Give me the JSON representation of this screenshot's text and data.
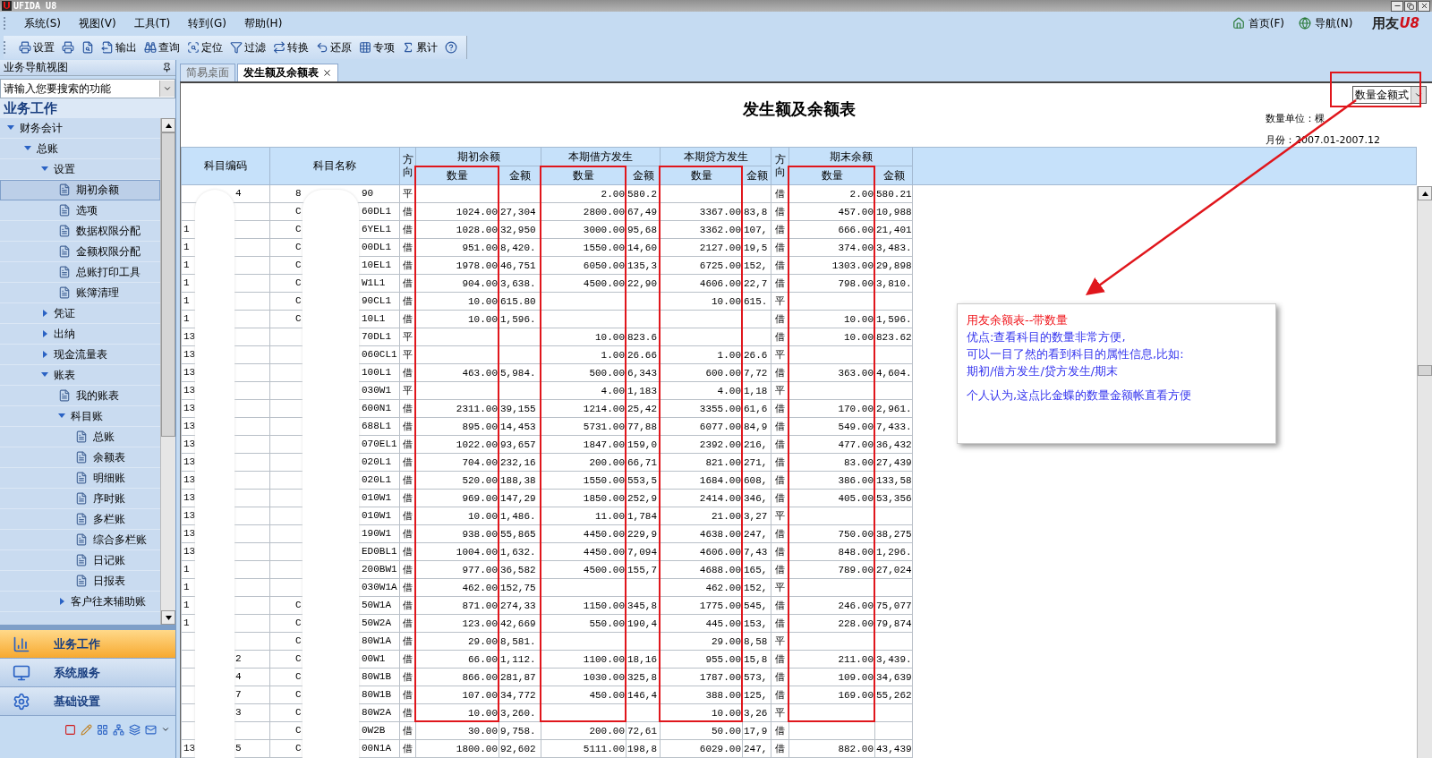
{
  "window": {
    "title": "UFIDA U8"
  },
  "menu": [
    "系统(S)",
    "视图(V)",
    "工具(T)",
    "转到(G)",
    "帮助(H)"
  ],
  "toolbar": [
    {
      "kind": "print",
      "label": "设置"
    },
    {
      "kind": "printer"
    },
    {
      "kind": "preview"
    },
    {
      "kind": "export",
      "label": "输出"
    },
    {
      "kind": "query",
      "label": "查询"
    },
    {
      "kind": "locate",
      "label": "定位"
    },
    {
      "kind": "filter",
      "label": "过滤"
    },
    {
      "kind": "convert",
      "label": "转换"
    },
    {
      "kind": "undo",
      "label": "还原"
    },
    {
      "kind": "grid",
      "label": "专项"
    },
    {
      "kind": "sum",
      "label": "累计"
    },
    {
      "kind": "help"
    }
  ],
  "top_links": [
    {
      "kind": "home",
      "label": "首页(F)"
    },
    {
      "kind": "globe",
      "label": "导航(N)"
    }
  ],
  "logo": {
    "text": "用友",
    "mark": "U8"
  },
  "sidebar": {
    "title": "业务导航视图",
    "search": "请输入您要搜索的功能",
    "section": "业务工作",
    "tree": [
      {
        "label": "财务会计",
        "expanded": true,
        "children": [
          {
            "label": "总账",
            "expanded": true,
            "children": [
              {
                "label": "设置",
                "expanded": true,
                "children": [
                  {
                    "label": "期初余额",
                    "selected": true
                  },
                  {
                    "label": "选项",
                    "selected": false
                  },
                  {
                    "label": "数据权限分配",
                    "selected": false
                  },
                  {
                    "label": "金额权限分配",
                    "selected": false
                  },
                  {
                    "label": "总账打印工具",
                    "selected": false
                  },
                  {
                    "label": "账簿清理",
                    "selected": false
                  }
                ]
              },
              {
                "label": "凭证",
                "expanded": false
              },
              {
                "label": "出纳",
                "expanded": false
              },
              {
                "label": "现金流量表",
                "expanded": false
              },
              {
                "label": "账表",
                "expanded": true,
                "children": [
                  {
                    "label": "我的账表",
                    "selected": false
                  },
                  {
                    "label": "科目账",
                    "expanded": true,
                    "children": [
                      {
                        "label": "总账",
                        "selected": false
                      },
                      {
                        "label": "余额表",
                        "selected": false
                      },
                      {
                        "label": "明细账",
                        "selected": false
                      },
                      {
                        "label": "序时账",
                        "selected": false
                      },
                      {
                        "label": "多栏账",
                        "selected": false
                      },
                      {
                        "label": "综合多栏账",
                        "selected": false
                      },
                      {
                        "label": "日记账",
                        "selected": false
                      },
                      {
                        "label": "日报表",
                        "selected": false
                      }
                    ]
                  },
                  {
                    "label": "客户往来辅助账",
                    "expanded": false
                  }
                ]
              }
            ]
          }
        ]
      }
    ],
    "nav_buttons": [
      {
        "kind": "chart",
        "label": "业务工作",
        "selected": true
      },
      {
        "kind": "monitor",
        "label": "系统服务",
        "selected": false
      },
      {
        "kind": "gear",
        "label": "基础设置",
        "selected": false
      }
    ]
  },
  "tabs": [
    {
      "label": "简易桌面",
      "selected": false,
      "closable": false
    },
    {
      "label": "发生额及余额表",
      "selected": true,
      "closable": true
    }
  ],
  "report": {
    "title": "发生额及余额表",
    "mode": "数量金额式",
    "unit": "数量单位：棵",
    "period": "月份：2007.01-2007.12",
    "header": [
      {
        "kind": "single",
        "label": "科目编码"
      },
      {
        "kind": "single",
        "label": "科目名称"
      },
      {
        "kind": "narrow",
        "label": "方向"
      },
      {
        "kind": "group",
        "title": "期初余额",
        "sub": [
          "数量",
          "金额"
        ]
      },
      {
        "kind": "group",
        "title": "本期借方发生",
        "sub": [
          "数量",
          "金额"
        ]
      },
      {
        "kind": "group",
        "title": "本期贷方发生",
        "sub": [
          "数量",
          "金额"
        ]
      },
      {
        "kind": "narrow",
        "label": "方向"
      },
      {
        "kind": "group",
        "title": "期末余额",
        "sub": [
          "数量",
          "金额"
        ]
      }
    ],
    "rows": [
      {
        "code_tail": "4",
        "name_head": "8",
        "name_tail": "90",
        "dir": "平",
        "debit_qty": "2.00",
        "debit_amt": "580.2",
        "end_dir": "借",
        "close_qty": "2.00",
        "close_amt": "580.21"
      },
      {
        "name_head": "C",
        "name_tail": "60DL1",
        "dir": "借",
        "open_qty": "1024.00",
        "open_amt": "27,304",
        "debit_qty": "2800.00",
        "debit_amt": "67,49",
        "credit_qty": "3367.00",
        "credit_amt": "83,8",
        "end_dir": "借",
        "close_qty": "457.00",
        "close_amt": "10,988"
      },
      {
        "code": "1",
        "name_head": "C",
        "name_tail": "6YEL1",
        "dir": "借",
        "open_qty": "1028.00",
        "open_amt": "32,950",
        "debit_qty": "3000.00",
        "debit_amt": "95,68",
        "credit_qty": "3362.00",
        "credit_amt": "107,",
        "end_dir": "借",
        "close_qty": "666.00",
        "close_amt": "21,401"
      },
      {
        "code": "1",
        "name_head": "C",
        "name_tail": "00DL1",
        "dir": "借",
        "open_qty": "951.00",
        "open_amt": "8,420.",
        "debit_qty": "1550.00",
        "debit_amt": "14,60",
        "credit_qty": "2127.00",
        "credit_amt": "19,5",
        "end_dir": "借",
        "close_qty": "374.00",
        "close_amt": "3,483."
      },
      {
        "code": "1",
        "name_head": "C",
        "name_tail": "10EL1",
        "dir": "借",
        "open_qty": "1978.00",
        "open_amt": "46,751",
        "debit_qty": "6050.00",
        "debit_amt": "135,3",
        "credit_qty": "6725.00",
        "credit_amt": "152,",
        "end_dir": "借",
        "close_qty": "1303.00",
        "close_amt": "29,898"
      },
      {
        "code": "1",
        "name_head": "C",
        "name_tail": "W1L1",
        "dir": "借",
        "open_qty": "904.00",
        "open_amt": "3,638.",
        "debit_qty": "4500.00",
        "debit_amt": "22,90",
        "credit_qty": "4606.00",
        "credit_amt": "22,7",
        "end_dir": "借",
        "close_qty": "798.00",
        "close_amt": "3,810."
      },
      {
        "code": "1",
        "name_head": "C",
        "name_tail": "90CL1",
        "dir": "借",
        "open_qty": "10.00",
        "open_amt": "615.80",
        "credit_qty": "10.00",
        "credit_amt": "615.",
        "end_dir": "平"
      },
      {
        "code": "1",
        "name_head": "C",
        "name_tail": "10L1",
        "dir": "借",
        "open_qty": "10.00",
        "open_amt": "1,596.",
        "end_dir": "借",
        "close_qty": "10.00",
        "close_amt": "1,596."
      },
      {
        "code": "13",
        "name_tail": "70DL1",
        "dir": "平",
        "debit_qty": "10.00",
        "debit_amt": "823.6",
        "end_dir": "借",
        "close_qty": "10.00",
        "close_amt": "823.62"
      },
      {
        "code": "13",
        "name_tail": "060CL1",
        "dir": "平",
        "debit_qty": "1.00",
        "debit_amt": "26.66",
        "credit_qty": "1.00",
        "credit_amt": "26.6",
        "end_dir": "平"
      },
      {
        "code": "13",
        "name_tail": "100L1",
        "dir": "借",
        "open_qty": "463.00",
        "open_amt": "5,984.",
        "debit_qty": "500.00",
        "debit_amt": "6,343",
        "credit_qty": "600.00",
        "credit_amt": "7,72",
        "end_dir": "借",
        "close_qty": "363.00",
        "close_amt": "4,604."
      },
      {
        "code": "13",
        "name_tail": "030W1",
        "dir": "平",
        "debit_qty": "4.00",
        "debit_amt": "1,183",
        "credit_qty": "4.00",
        "credit_amt": "1,18",
        "end_dir": "平"
      },
      {
        "code": "13",
        "name_tail": "600N1",
        "dir": "借",
        "open_qty": "2311.00",
        "open_amt": "39,155",
        "debit_qty": "1214.00",
        "debit_amt": "25,42",
        "credit_qty": "3355.00",
        "credit_amt": "61,6",
        "end_dir": "借",
        "close_qty": "170.00",
        "close_amt": "2,961."
      },
      {
        "code": "13",
        "name_tail": "688L1",
        "dir": "借",
        "open_qty": "895.00",
        "open_amt": "14,453",
        "debit_qty": "5731.00",
        "debit_amt": "77,88",
        "credit_qty": "6077.00",
        "credit_amt": "84,9",
        "end_dir": "借",
        "close_qty": "549.00",
        "close_amt": "7,433."
      },
      {
        "code": "13",
        "name_tail": "070EL1",
        "dir": "借",
        "open_qty": "1022.00",
        "open_amt": "93,657",
        "debit_qty": "1847.00",
        "debit_amt": "159,0",
        "credit_qty": "2392.00",
        "credit_amt": "216,",
        "end_dir": "借",
        "close_qty": "477.00",
        "close_amt": "36,432"
      },
      {
        "code": "13",
        "name_tail": "020L1",
        "dir": "借",
        "open_qty": "704.00",
        "open_amt": "232,16",
        "debit_qty": "200.00",
        "debit_amt": "66,71",
        "credit_qty": "821.00",
        "credit_amt": "271,",
        "end_dir": "借",
        "close_qty": "83.00",
        "close_amt": "27,439"
      },
      {
        "code": "13",
        "name_tail": "020L1",
        "dir": "借",
        "open_qty": "520.00",
        "open_amt": "188,38",
        "debit_qty": "1550.00",
        "debit_amt": "553,5",
        "credit_qty": "1684.00",
        "credit_amt": "608,",
        "end_dir": "借",
        "close_qty": "386.00",
        "close_amt": "133,58"
      },
      {
        "code": "13",
        "name_tail": "010W1",
        "dir": "借",
        "open_qty": "969.00",
        "open_amt": "147,29",
        "debit_qty": "1850.00",
        "debit_amt": "252,9",
        "credit_qty": "2414.00",
        "credit_amt": "346,",
        "end_dir": "借",
        "close_qty": "405.00",
        "close_amt": "53,356"
      },
      {
        "code": "13",
        "name_tail": "010W1",
        "dir": "借",
        "open_qty": "10.00",
        "open_amt": "1,486.",
        "debit_qty": "11.00",
        "debit_amt": "1,784",
        "credit_qty": "21.00",
        "credit_amt": "3,27",
        "end_dir": "平"
      },
      {
        "code": "13",
        "name_tail": "190W1",
        "dir": "借",
        "open_qty": "938.00",
        "open_amt": "55,865",
        "debit_qty": "4450.00",
        "debit_amt": "229,9",
        "credit_qty": "4638.00",
        "credit_amt": "247,",
        "end_dir": "借",
        "close_qty": "750.00",
        "close_amt": "38,275"
      },
      {
        "code": "13",
        "name_tail": "ED0BL1",
        "dir": "借",
        "open_qty": "1004.00",
        "open_amt": "1,632.",
        "debit_qty": "4450.00",
        "debit_amt": "7,094",
        "credit_qty": "4606.00",
        "credit_amt": "7,43",
        "end_dir": "借",
        "close_qty": "848.00",
        "close_amt": "1,296."
      },
      {
        "code": "1",
        "name_tail": "200BW1",
        "dir": "借",
        "open_qty": "977.00",
        "open_amt": "36,582",
        "debit_qty": "4500.00",
        "debit_amt": "155,7",
        "credit_qty": "4688.00",
        "credit_amt": "165,",
        "end_dir": "借",
        "close_qty": "789.00",
        "close_amt": "27,024"
      },
      {
        "code": "1",
        "name_tail": "030W1A",
        "dir": "借",
        "open_qty": "462.00",
        "open_amt": "152,75",
        "credit_qty": "462.00",
        "credit_amt": "152,",
        "end_dir": "平"
      },
      {
        "code": "1",
        "name_head": "C",
        "name_tail": "50W1A",
        "dir": "借",
        "open_qty": "871.00",
        "open_amt": "274,33",
        "debit_qty": "1150.00",
        "debit_amt": "345,8",
        "credit_qty": "1775.00",
        "credit_amt": "545,",
        "end_dir": "借",
        "close_qty": "246.00",
        "close_amt": "75,077"
      },
      {
        "code": "1",
        "name_head": "C",
        "name_tail": "50W2A",
        "dir": "借",
        "open_qty": "123.00",
        "open_amt": "42,669",
        "debit_qty": "550.00",
        "debit_amt": "190,4",
        "credit_qty": "445.00",
        "credit_amt": "153,",
        "end_dir": "借",
        "close_qty": "228.00",
        "close_amt": "79,874"
      },
      {
        "name_head": "C",
        "name_tail": "80W1A",
        "dir": "借",
        "open_qty": "29.00",
        "open_amt": "8,581.",
        "credit_qty": "29.00",
        "credit_amt": "8,58",
        "end_dir": "平"
      },
      {
        "code_tail": "2",
        "name_head": "C",
        "name_tail": "00W1",
        "dir": "借",
        "open_qty": "66.00",
        "open_amt": "1,112.",
        "debit_qty": "1100.00",
        "debit_amt": "18,16",
        "credit_qty": "955.00",
        "credit_amt": "15,8",
        "end_dir": "借",
        "close_qty": "211.00",
        "close_amt": "3,439."
      },
      {
        "code_tail": "4",
        "name_head": "C",
        "name_tail": "80W1B",
        "dir": "借",
        "open_qty": "866.00",
        "open_amt": "281,87",
        "debit_qty": "1030.00",
        "debit_amt": "325,8",
        "credit_qty": "1787.00",
        "credit_amt": "573,",
        "end_dir": "借",
        "close_qty": "109.00",
        "close_amt": "34,639"
      },
      {
        "code_tail": "7",
        "name_head": "C",
        "name_tail": "80W1B",
        "dir": "借",
        "open_qty": "107.00",
        "open_amt": "34,772",
        "debit_qty": "450.00",
        "debit_amt": "146,4",
        "credit_qty": "388.00",
        "credit_amt": "125,",
        "end_dir": "借",
        "close_qty": "169.00",
        "close_amt": "55,262"
      },
      {
        "code_tail": "3",
        "name_head": "C",
        "name_tail": "80W2A",
        "dir": "借",
        "open_qty": "10.00",
        "open_amt": "3,260.",
        "credit_qty": "10.00",
        "credit_amt": "3,26",
        "end_dir": "平"
      },
      {
        "name_head": "C",
        "name_tail": "0W2B",
        "dir": "借",
        "open_qty": "30.00",
        "open_amt": "9,758.",
        "debit_qty": "200.00",
        "debit_amt": "72,61",
        "credit_qty": "50.00",
        "credit_amt": "17,9",
        "end_dir": "借"
      },
      {
        "code": "13",
        "code_tail": "5",
        "name_head": "C",
        "name_tail": "00N1A",
        "dir": "借",
        "open_qty": "1800.00",
        "open_amt": "92,602",
        "debit_qty": "5111.00",
        "debit_amt": "198,8",
        "credit_qty": "6029.00",
        "credit_amt": "247,",
        "end_dir": "借",
        "close_qty": "882.00",
        "close_amt": "43,439"
      }
    ]
  },
  "note": [
    {
      "kind": "heading",
      "text": "用友余额表--带数量"
    },
    {
      "kind": "body",
      "text": "优点:查看科目的数量非常方便,"
    },
    {
      "kind": "body",
      "text": "可以一目了然的看到科目的属性信息,比如:"
    },
    {
      "kind": "body",
      "text": "期初/借方发生/贷方发生/期末"
    },
    {
      "kind": "remark",
      "text": "个人认为,这点比金蝶的数量金额帐直看方便"
    }
  ]
}
